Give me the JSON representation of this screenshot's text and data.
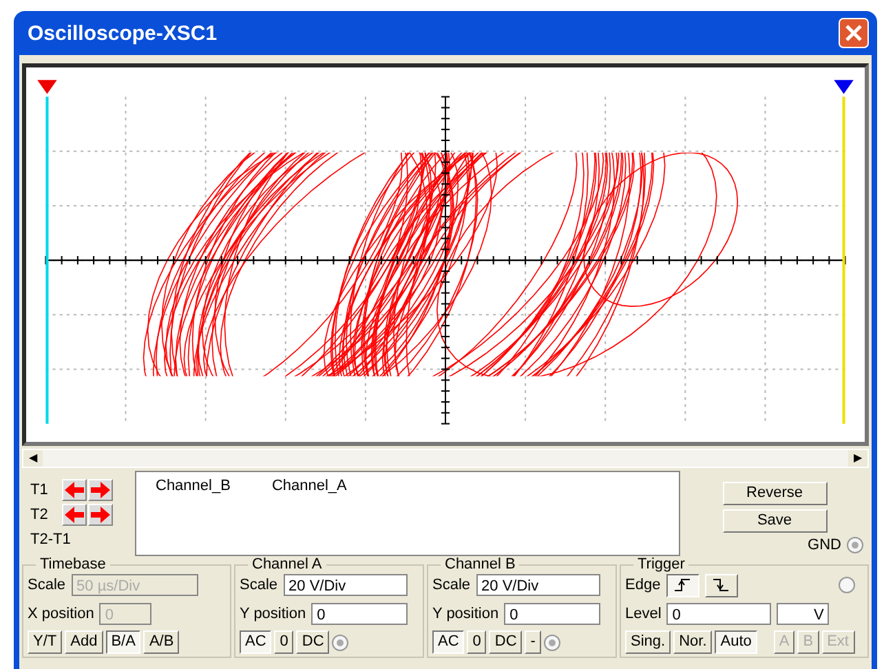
{
  "window": {
    "title": "Oscilloscope-XSC1"
  },
  "cursors": [
    {
      "label": "T1",
      "kind": "arrows"
    },
    {
      "label": "T2",
      "kind": "arrows"
    },
    {
      "label": "T2-T1",
      "kind": "plain"
    }
  ],
  "readout": {
    "columns": [
      "Channel_B",
      "Channel_A"
    ]
  },
  "buttons": [
    "Reverse",
    "Save"
  ],
  "scrollbar": {
    "left": "◀",
    "right": "▶"
  },
  "gnd": {
    "label": "GND",
    "checked": true
  },
  "timebase": {
    "title": "Timebase",
    "scale_label": "Scale",
    "scale_value": "50 µs/Div",
    "scale_disabled": true,
    "x_label": "X position",
    "x_value": "0",
    "x_disabled": true,
    "modes": [
      {
        "label": "Y/T",
        "selected": false
      },
      {
        "label": "Add",
        "selected": false
      },
      {
        "label": "B/A",
        "selected": true
      },
      {
        "label": "A/B",
        "selected": false
      }
    ]
  },
  "channels": [
    {
      "title": "Channel A",
      "scale_label": "Scale",
      "scale_value": "20  V/Div",
      "y_label": "Y position",
      "y_value": "0",
      "coupling": [
        {
          "label": "AC",
          "selected": true
        },
        {
          "label": "0",
          "selected": false
        },
        {
          "label": "DC",
          "selected": false
        }
      ],
      "radio_checked": true
    },
    {
      "title": "Channel B",
      "scale_label": "Scale",
      "scale_value": "20  V/Div",
      "y_label": "Y position",
      "y_value": "0",
      "coupling": [
        {
          "label": "AC",
          "selected": true
        },
        {
          "label": "0",
          "selected": false
        },
        {
          "label": "DC",
          "selected": false
        },
        {
          "label": "-",
          "selected": false
        }
      ],
      "radio_checked": true
    }
  ],
  "trigger": {
    "title": "Trigger",
    "edge_label": "Edge",
    "edges": [
      {
        "kind": "rising",
        "selected": true
      },
      {
        "kind": "falling",
        "selected": false
      }
    ],
    "radio_checked": false,
    "level_label": "Level",
    "level_value": "0",
    "level_unit": "V",
    "modes": [
      {
        "label": "Sing.",
        "selected": false
      },
      {
        "label": "Nor.",
        "selected": false
      },
      {
        "label": "Auto",
        "selected": true
      }
    ],
    "sources": [
      {
        "label": "A",
        "disabled": true
      },
      {
        "label": "B",
        "disabled": true
      },
      {
        "label": "Ext",
        "disabled": true
      }
    ]
  }
}
